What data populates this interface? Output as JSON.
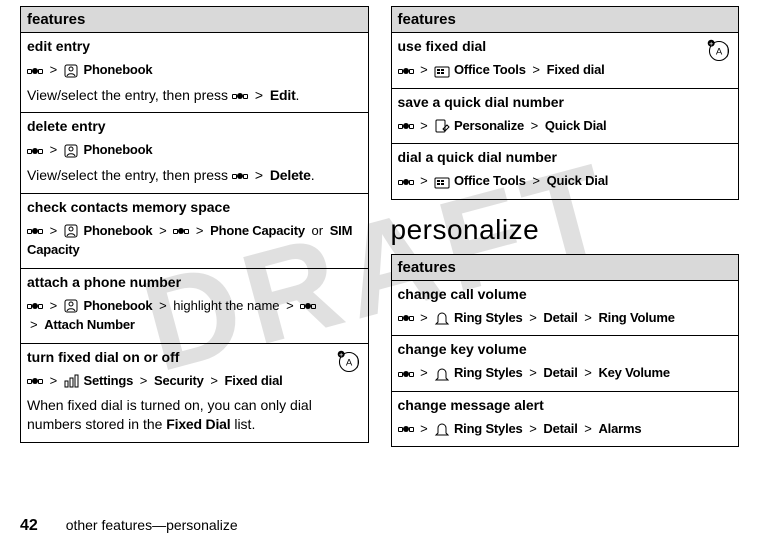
{
  "watermark": "DRAFT",
  "left": {
    "header": "features",
    "rows": [
      {
        "title": "edit entry",
        "nav_label": "Phonebook",
        "nav_icon": "phonebook",
        "desc_pre": "View/select the entry, then press ",
        "desc_tail": "Edit",
        "desc_gt": ">",
        "extra": ""
      },
      {
        "title": "delete entry",
        "nav_label": "Phonebook",
        "nav_icon": "phonebook",
        "desc_pre": "View/select the entry, then press ",
        "desc_tail": "Delete",
        "desc_gt": ">",
        "extra": ""
      },
      {
        "title": "check contacts memory space",
        "nav_label": "Phonebook",
        "nav_icon": "phonebook",
        "gt": ">",
        "mid_label": "Phone Capacity",
        "or": "or",
        "end_label": "SIM Capacity"
      },
      {
        "title": "attach a phone number",
        "nav_label": "Phonebook",
        "nav_icon": "phonebook",
        "gt": ">",
        "mid_text": "highlight the name",
        "gt2": ">",
        "end_label": "Attach Number"
      },
      {
        "title": "turn fixed dial on or off",
        "nav_icon": "settings",
        "nav_label": "Settings",
        "gt": ">",
        "mid_label": "Security",
        "gt2": ">",
        "end_label": "Fixed dial",
        "desc": "When fixed dial is turned on, you can only dial numbers stored in the ",
        "desc_bold": "Fixed Dial",
        "desc_tail": " list.",
        "badge": true
      }
    ]
  },
  "right_top": {
    "header": "features",
    "rows": [
      {
        "title": "use fixed dial",
        "nav_icon": "office",
        "nav_label": "Office Tools",
        "gt": ">",
        "end_label": "Fixed dial",
        "badge": true
      },
      {
        "title": "save a quick dial number",
        "nav_icon": "personalize",
        "nav_label": "Personalize",
        "gt": ">",
        "end_label": "Quick Dial"
      },
      {
        "title": "dial a quick dial number",
        "nav_icon": "office",
        "nav_label": "Office Tools",
        "gt": ">",
        "end_label": "Quick Dial"
      }
    ]
  },
  "section_heading": "personalize",
  "right_bottom": {
    "header": "features",
    "rows": [
      {
        "title": "change call volume",
        "nav_icon": "ring",
        "nav_label": "Ring Styles",
        "gt": ">",
        "mid_label": "Detail",
        "gt2": ">",
        "end_label": "Ring Volume"
      },
      {
        "title": "change key volume",
        "nav_icon": "ring",
        "nav_label": "Ring Styles",
        "gt": ">",
        "mid_label": "Detail",
        "gt2": ">",
        "end_label": "Key Volume"
      },
      {
        "title": "change message alert",
        "nav_icon": "ring",
        "nav_label": "Ring Styles",
        "gt": ">",
        "mid_label": "Detail",
        "gt2": ">",
        "end_label": "Alarms"
      }
    ]
  },
  "footer": {
    "page": "42",
    "text": "other features—personalize"
  },
  "symbols": {
    "gt": ">"
  }
}
